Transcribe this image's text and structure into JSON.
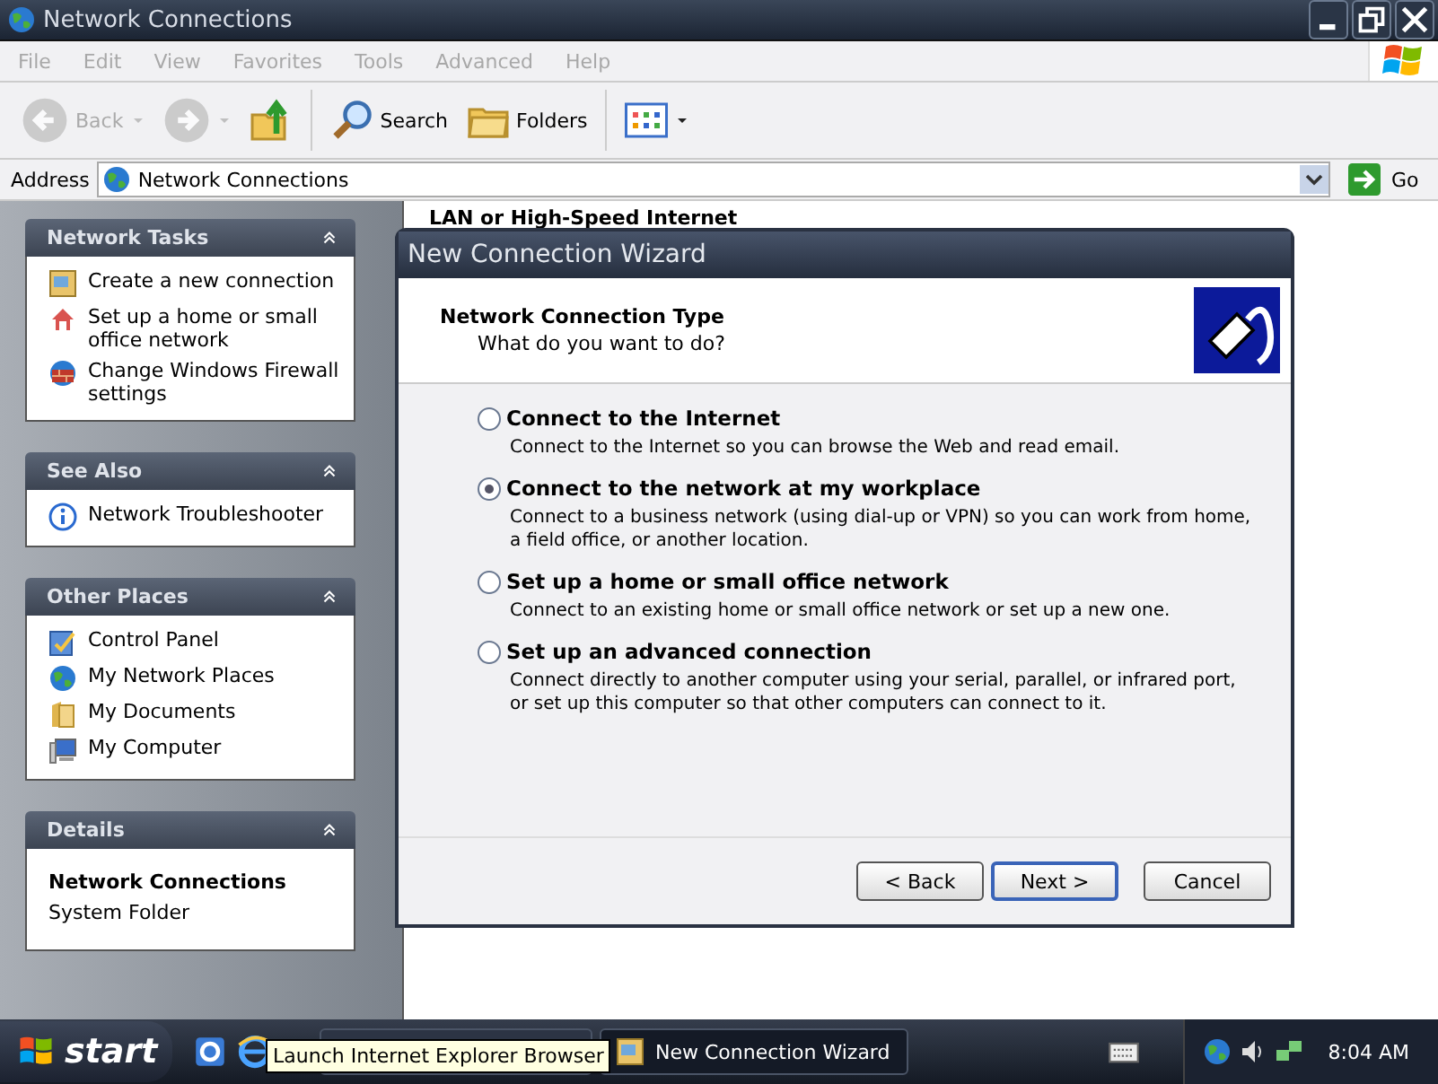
{
  "window": {
    "title": "Network Connections"
  },
  "menu": [
    "File",
    "Edit",
    "View",
    "Favorites",
    "Tools",
    "Advanced",
    "Help"
  ],
  "toolbar": [
    {
      "kind": "back",
      "label": "Back",
      "disabled": true
    },
    {
      "kind": "forward",
      "disabled": true
    },
    {
      "kind": "up",
      "disabled": false
    },
    {
      "kind": "search",
      "label": "Search",
      "disabled": false
    },
    {
      "kind": "folders",
      "label": "Folders",
      "disabled": false
    },
    {
      "kind": "views",
      "disabled": false
    }
  ],
  "address": {
    "label": "Address",
    "value": "Network Connections",
    "go": "Go"
  },
  "sidebar": [
    {
      "title": "Network Tasks",
      "kind": "links",
      "items": [
        {
          "label": "Create a new connection",
          "kind": "connection"
        },
        {
          "label": "Set up a home or small office network",
          "kind": "home"
        },
        {
          "label": "Change Windows Firewall settings",
          "kind": "firewall"
        }
      ]
    },
    {
      "title": "See Also",
      "kind": "links",
      "items": [
        {
          "label": "Network Troubleshooter",
          "kind": "info"
        }
      ]
    },
    {
      "title": "Other Places",
      "kind": "links",
      "items": [
        {
          "label": "Control Panel",
          "kind": "panel"
        },
        {
          "label": "My Network Places",
          "kind": "globe"
        },
        {
          "label": "My Documents",
          "kind": "folder"
        },
        {
          "label": "My Computer",
          "kind": "computer"
        }
      ]
    },
    {
      "title": "Details",
      "kind": "details",
      "name": "Network Connections",
      "type": "System Folder"
    }
  ],
  "content": {
    "group_heading": "LAN or High-Speed Internet"
  },
  "wizard": {
    "title": "New Connection Wizard",
    "heading": "Network Connection Type",
    "subheading": "What do you want to do?",
    "options": [
      {
        "label": "Connect to the Internet",
        "description": "Connect to the Internet so you can browse the Web and read email.",
        "selected": false
      },
      {
        "label": "Connect to the network at my workplace",
        "description": "Connect to a business network (using dial-up or VPN) so you can work from home, a field office, or another location.",
        "selected": true
      },
      {
        "label": "Set up a home or small office network",
        "description": "Connect to an existing home or small office network or set up a new one.",
        "selected": false
      },
      {
        "label": "Set up an advanced connection",
        "description": "Connect directly to another computer using your serial, parallel, or infrared port, or set up this computer so that other computers can connect to it.",
        "selected": false
      }
    ],
    "buttons": [
      {
        "label": "< Back",
        "default": false
      },
      {
        "label": "Next >",
        "default": true
      },
      {
        "label": "Cancel",
        "default": false
      }
    ]
  },
  "taskbar": {
    "start": "start",
    "tasks": [
      {
        "active": false
      },
      {
        "label": "New Connection Wizard",
        "active": true
      }
    ],
    "tooltip": "Launch Internet Explorer Browser",
    "clock": "8:04 AM"
  }
}
